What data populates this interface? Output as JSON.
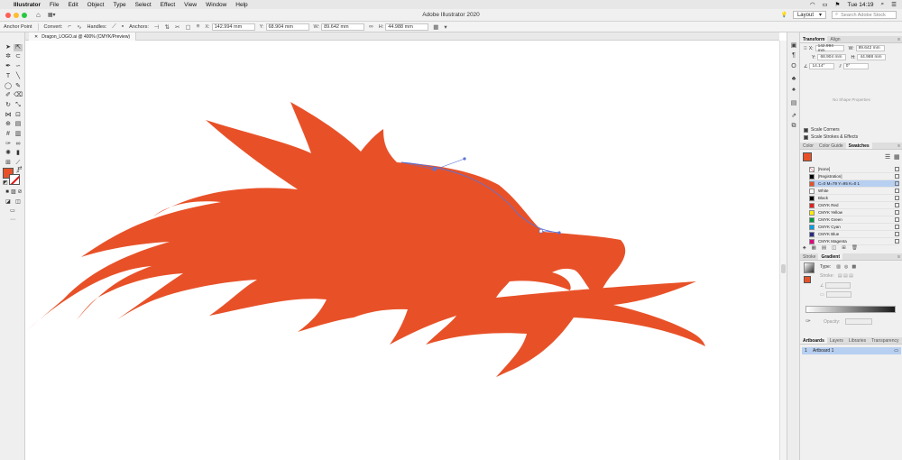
{
  "menubar": {
    "items": [
      "Illustrator",
      "File",
      "Edit",
      "Object",
      "Type",
      "Select",
      "Effect",
      "View",
      "Window",
      "Help"
    ],
    "clock": "Tue 14:19"
  },
  "appbar": {
    "title": "Adobe Illustrator 2020",
    "workspace": "Layout",
    "search_placeholder": "Search Adobe Stock"
  },
  "control": {
    "tool_label": "Anchor Point",
    "convert_label": "Convert:",
    "handles_label": "Handles:",
    "anchors_label": "Anchors:",
    "x_label": "X:",
    "x_value": "142.994 mm",
    "y_label": "Y:",
    "y_value": "68.904 mm",
    "w_label": "W:",
    "w_value": "89.642 mm",
    "h_label": "H:",
    "h_value": "44.988 mm"
  },
  "document": {
    "tab_label": "Dragon_LOGO.ai @ 400% (CMYK/Preview)"
  },
  "transform_panel": {
    "tabs": [
      "Transform",
      "Align"
    ],
    "x_label": "X:",
    "x_value": "142.994 mm",
    "y_label": "Y:",
    "y_value": "68.904 mm",
    "w_label": "W:",
    "w_value": "89.642 mm",
    "h_label": "H:",
    "h_value": "44.988 mm",
    "angle_value": "14.14°",
    "shear_value": "0°",
    "no_shape": "No Shape Properties",
    "scale_corners": "Scale Corners",
    "scale_strokes": "Scale Strokes & Effects"
  },
  "swatches_panel": {
    "tabs": [
      "Color",
      "Color Guide",
      "Swatches"
    ],
    "items": [
      {
        "name": "[None]",
        "color": "#ffffff"
      },
      {
        "name": "[Registration]",
        "color": "#000000"
      },
      {
        "name": "C=0 M=79 Y=95 K=0 1",
        "color": "#e85128"
      },
      {
        "name": "White",
        "color": "#ffffff"
      },
      {
        "name": "Black",
        "color": "#000000"
      },
      {
        "name": "CMYK Red",
        "color": "#e3201b"
      },
      {
        "name": "CMYK Yellow",
        "color": "#ffed00"
      },
      {
        "name": "CMYK Green",
        "color": "#009a3d"
      },
      {
        "name": "CMYK Cyan",
        "color": "#009ee3"
      },
      {
        "name": "CMYK Blue",
        "color": "#2a2a86"
      },
      {
        "name": "CMYK Magenta",
        "color": "#e3007e"
      }
    ]
  },
  "gradient_panel": {
    "tabs": [
      "Stroke",
      "Gradient"
    ],
    "type_label": "Type:",
    "stroke_label": "Stroke:",
    "opacity_label": "Opacity:"
  },
  "artboards_panel": {
    "tabs": [
      "Artboards",
      "Layers",
      "Libraries",
      "Transparency"
    ],
    "artboard_number": "1",
    "artboard_name": "Artboard 1"
  },
  "colors": {
    "fill": "#e85128",
    "selection": "#5b73d8"
  }
}
